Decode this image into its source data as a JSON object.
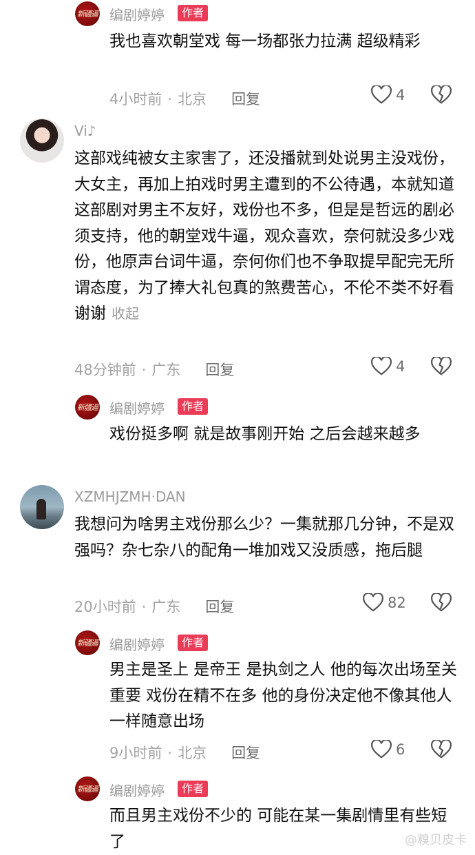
{
  "comments": [
    {
      "user": "编剧婷婷",
      "badge": "作者",
      "text": "我也喜欢朝堂戏 每一场都张力拉满 超级精彩",
      "time": "4小时前",
      "location": "北京",
      "reply": "回复",
      "likes": "4"
    },
    {
      "user": "Vi♪",
      "text": "这部戏纯被女主家害了，还没播就到处说男主没戏份，大女主，再加上拍戏时男主遭到的不公待遇，本就知道这部剧对男主不友好，戏份也不多，但是是哲远的剧必须支持，他的朝堂戏牛逼，观众喜欢，奈何就没多少戏份，他原声台词牛逼，奈何你们也不争取提早配完无所谓态度，为了捧大礼包真的煞费苦心，不伦不类不好看谢谢",
      "collapse": "收起",
      "time": "48分钟前",
      "location": "广东",
      "reply": "回复",
      "likes": "4"
    },
    {
      "user": "编剧婷婷",
      "badge": "作者",
      "text": "戏份挺多啊 就是故事刚开始 之后会越来越多"
    },
    {
      "user": "XZMHJZMH·DAN",
      "text": "我想问为啥男主戏份那么少？一集就那几分钟，不是双强吗？杂七杂八的配角一堆加戏又没质感，拖后腿",
      "time": "20小时前",
      "location": "广东",
      "reply": "回复",
      "likes": "82"
    },
    {
      "user": "编剧婷婷",
      "badge": "作者",
      "text": "男主是圣上 是帝王 是执剑之人 他的每次出场至关重要 戏份在精不在多 他的身份决定他不像其他人一样随意出场",
      "time": "9小时前",
      "location": "北京",
      "reply": "回复",
      "likes": "6"
    },
    {
      "user": "编剧婷婷",
      "badge": "作者",
      "text": "而且男主戏份不少的 可能在某一集剧情里有些短了"
    }
  ],
  "author_logo_text": "新疆逼",
  "watermark": "@糗贝皮卡",
  "icons": {
    "like": "heart-outline-icon",
    "dislike": "broken-heart-icon"
  },
  "colors": {
    "badge": "#ea3c57",
    "meta": "#a3a3a3",
    "username": "#9b9b9b"
  }
}
